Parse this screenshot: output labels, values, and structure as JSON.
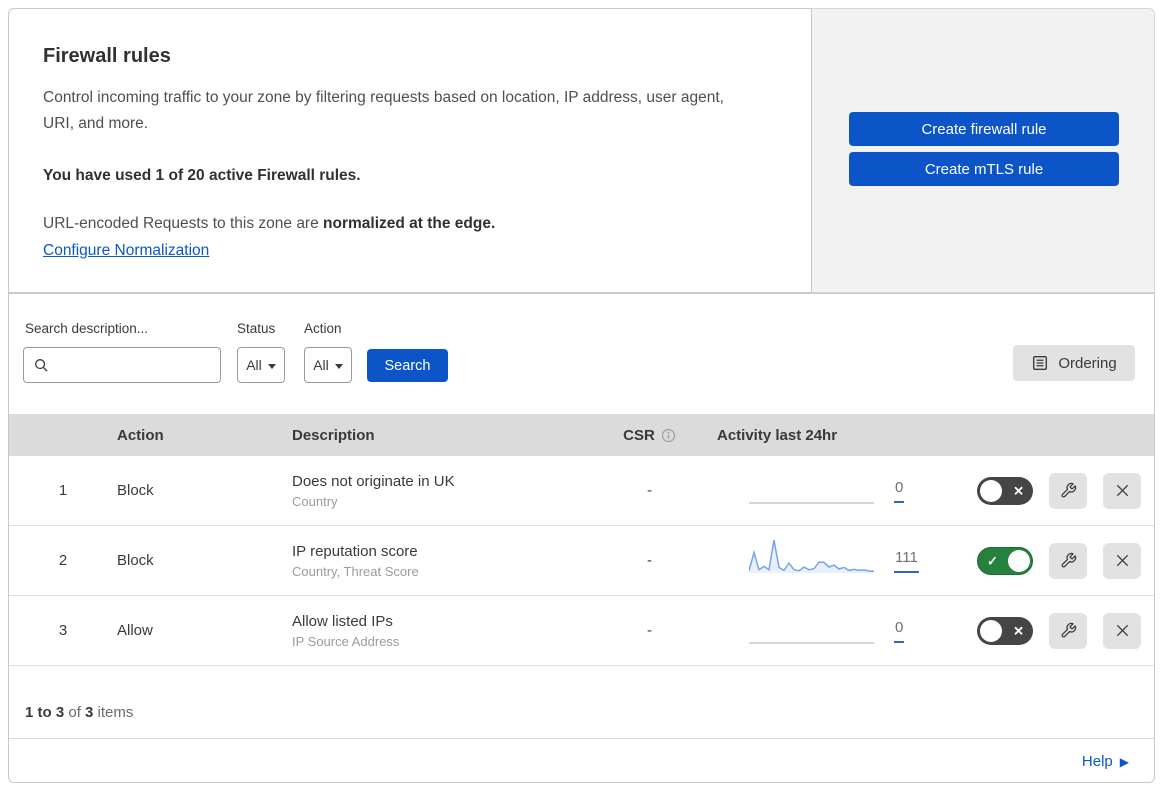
{
  "colors": {
    "accent_blue": "#0b55c8",
    "toggle_on_green": "#26803e",
    "toggle_off_gray": "#454545",
    "sparkline_blue": "#76a3ea",
    "panel_gray": "#f2f2f2",
    "table_header_gray": "#dbdbdb"
  },
  "header": {
    "title": "Firewall rules",
    "description": "Control incoming traffic to your zone by filtering requests based on location, IP address, user agent, URI, and more.",
    "usage_notice": "You have used 1 of 20 active Firewall rules.",
    "normalization_text": "URL-encoded Requests to this zone are ",
    "normalization_bold": "normalized at the edge.",
    "normalization_link": "Configure Normalization",
    "create_firewall_rule_button": "Create firewall rule",
    "create_mtls_rule_button": "Create mTLS rule"
  },
  "filters": {
    "search_label": "Search description...",
    "status_label": "Status",
    "status_value": "All",
    "action_label": "Action",
    "action_value": "All",
    "search_button": "Search",
    "ordering_button": "Ordering"
  },
  "table": {
    "columns": {
      "action": "Action",
      "description": "Description",
      "csr": "CSR",
      "activity": "Activity last 24hr"
    },
    "rows": [
      {
        "priority": "1",
        "action": "Block",
        "description": "Does not originate in UK",
        "criteria": "Country",
        "csr": "-",
        "activity_count": "0",
        "enabled": false,
        "sparkline": null
      },
      {
        "priority": "2",
        "action": "Block",
        "description": "IP reputation score",
        "criteria": "Country, Threat Score",
        "csr": "-",
        "activity_count": "111",
        "enabled": true,
        "sparkline": [
          0.07,
          0.62,
          0.1,
          0.2,
          0.1,
          1.0,
          0.17,
          0.08,
          0.3,
          0.1,
          0.07,
          0.18,
          0.1,
          0.13,
          0.33,
          0.32,
          0.18,
          0.24,
          0.12,
          0.17,
          0.08,
          0.11,
          0.08,
          0.09,
          0.06,
          0.05
        ]
      },
      {
        "priority": "3",
        "action": "Allow",
        "description": "Allow listed IPs",
        "criteria": "IP Source Address",
        "csr": "-",
        "activity_count": "0",
        "enabled": false,
        "sparkline": null
      }
    ]
  },
  "footer": {
    "count_range": "1 to 3",
    "count_of": " of ",
    "count_total": "3",
    "count_items": " items",
    "help_label": "Help"
  }
}
